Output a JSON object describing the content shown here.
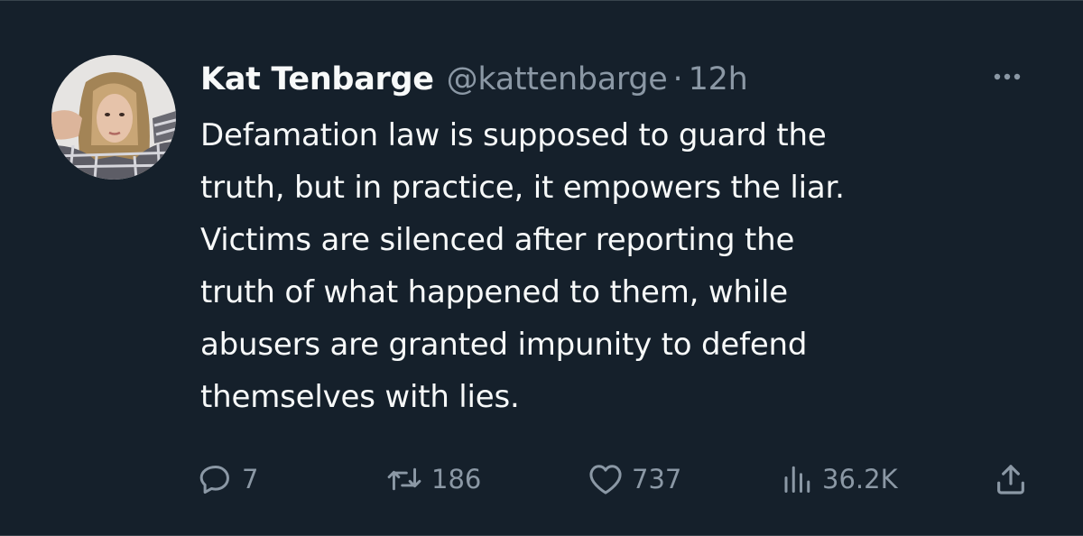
{
  "tweet": {
    "display_name": "Kat Tenbarge",
    "handle": "@kattenbarge",
    "separator": "·",
    "time": "12h",
    "text": "Defamation law is supposed to guard the\ntruth, but in practice, it empowers the liar.\nVictims are silenced after reporting the\ntruth of what happened to them, while\nabusers are granted impunity to defend\nthemselves with lies."
  },
  "actions": {
    "reply_count": "7",
    "retweet_count": "186",
    "like_count": "737",
    "views_count": "36.2K"
  },
  "icons": {
    "more": "more-horizontal-icon",
    "reply": "reply-icon",
    "retweet": "retweet-icon",
    "like": "heart-icon",
    "views": "views-icon",
    "share": "share-icon"
  },
  "colors": {
    "background": "#15202b",
    "primary_text": "#f7f9f9",
    "secondary_text": "#8b98a5"
  }
}
